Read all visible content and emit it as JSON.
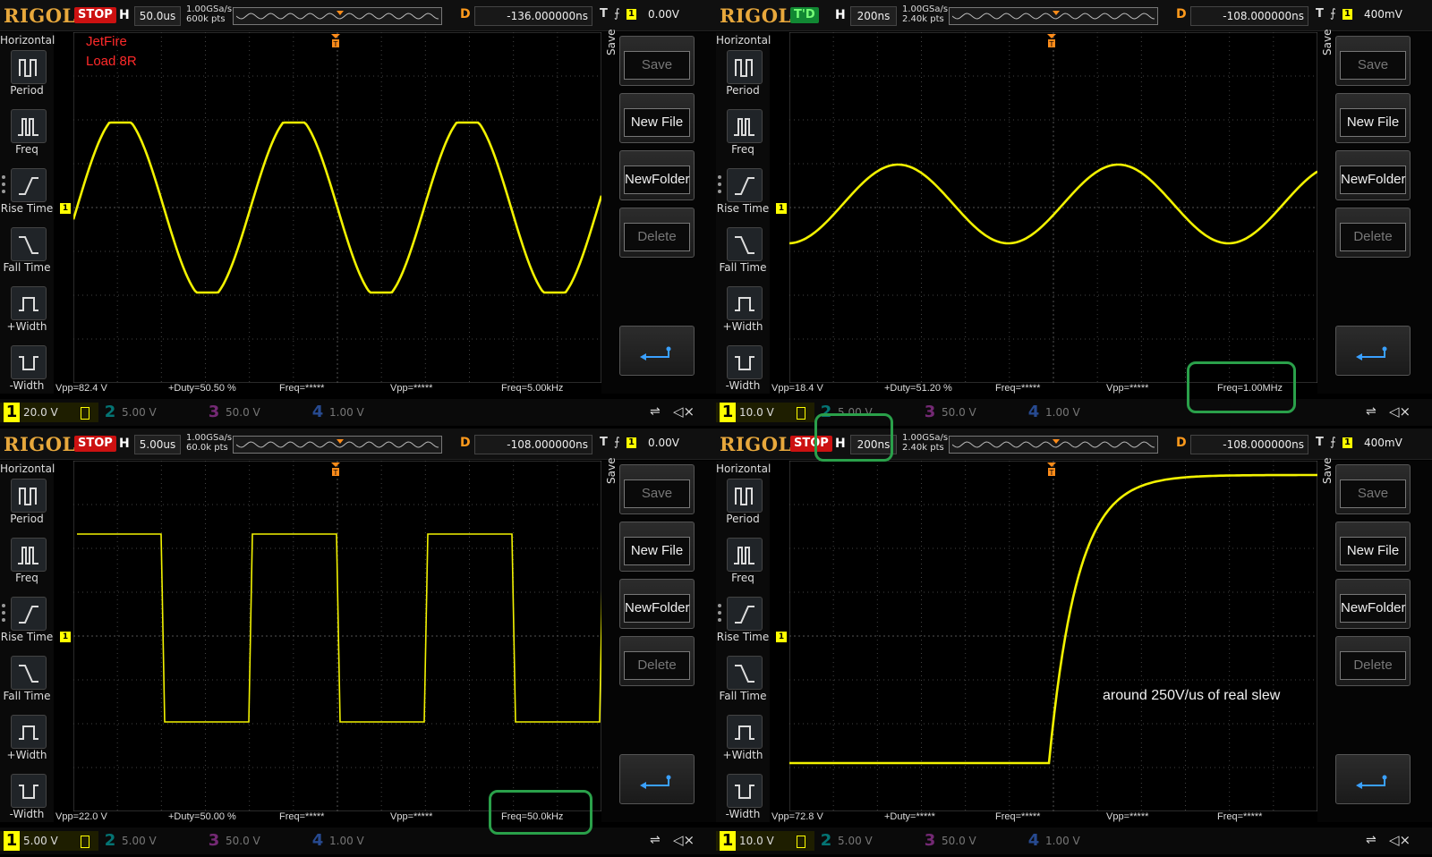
{
  "panels": [
    {
      "brand": "RIGOL",
      "status": "STOP",
      "status_type": "stop",
      "h_label": "H",
      "timebase": "50.0us",
      "sa_rate": "1.00GSa/s",
      "mem_depth": "600k pts",
      "d_label": "D",
      "delay": "-136.000000ns",
      "t_label": "T",
      "trigger_slope": "⨍",
      "trigger_ch": "1",
      "trigger_level": "0.00V",
      "side_title": "Horizontal",
      "side_items": [
        "Period",
        "Freq",
        "Rise Time",
        "Fall Time",
        "+Width",
        "-Width"
      ],
      "softkey_title": "Save",
      "softkeys": [
        "Save",
        "New File",
        "NewFolder",
        "Delete"
      ],
      "measurements": [
        "Vpp=82.4 V",
        "+Duty=50.50 %",
        "Freq=*****",
        "Vpp=*****",
        "Freq=5.00kHz"
      ],
      "channels": [
        {
          "num": "1",
          "scale": "20.0 V",
          "color": "#ffff00"
        },
        {
          "num": "2",
          "scale": "5.00 V",
          "color": "#00cccc"
        },
        {
          "num": "3",
          "scale": "50.0 V",
          "color": "#cc44cc"
        },
        {
          "num": "4",
          "scale": "1.00 V",
          "color": "#3f7fff"
        }
      ],
      "annotations": [
        "JetFire",
        "Load 8R"
      ],
      "waveform": "sine-clipped"
    },
    {
      "brand": "RIGOL",
      "status": "T'D",
      "status_type": "td",
      "h_label": "H",
      "timebase": "200ns",
      "sa_rate": "1.00GSa/s",
      "mem_depth": "2.40k pts",
      "d_label": "D",
      "delay": "-108.000000ns",
      "t_label": "T",
      "trigger_slope": "⨍",
      "trigger_ch": "1",
      "trigger_level": "400mV",
      "side_title": "Horizontal",
      "side_items": [
        "Period",
        "Freq",
        "Rise Time",
        "Fall Time",
        "+Width",
        "-Width"
      ],
      "softkey_title": "Save",
      "softkeys": [
        "Save",
        "New File",
        "NewFolder",
        "Delete"
      ],
      "measurements": [
        "Vpp=18.4 V",
        "+Duty=51.20 %",
        "Freq=*****",
        "Vpp=*****",
        "Freq=1.00MHz"
      ],
      "channels": [
        {
          "num": "1",
          "scale": "10.0 V",
          "color": "#ffff00"
        },
        {
          "num": "2",
          "scale": "5.00 V",
          "color": "#00cccc"
        },
        {
          "num": "3",
          "scale": "50.0 V",
          "color": "#cc44cc"
        },
        {
          "num": "4",
          "scale": "1.00 V",
          "color": "#3f7fff"
        }
      ],
      "annotations": [],
      "waveform": "sine-small"
    },
    {
      "brand": "RIGOL",
      "status": "STOP",
      "status_type": "stop",
      "h_label": "H",
      "timebase": "5.00us",
      "sa_rate": "1.00GSa/s",
      "mem_depth": "60.0k pts",
      "d_label": "D",
      "delay": "-108.000000ns",
      "t_label": "T",
      "trigger_slope": "⨍",
      "trigger_ch": "1",
      "trigger_level": "0.00V",
      "side_title": "Horizontal",
      "side_items": [
        "Period",
        "Freq",
        "Rise Time",
        "Fall Time",
        "+Width",
        "-Width"
      ],
      "softkey_title": "Save",
      "softkeys": [
        "Save",
        "New File",
        "NewFolder",
        "Delete"
      ],
      "measurements": [
        "Vpp=22.0 V",
        "+Duty=50.00 %",
        "Freq=*****",
        "Vpp=*****",
        "Freq=50.0kHz"
      ],
      "channels": [
        {
          "num": "1",
          "scale": "5.00 V",
          "color": "#ffff00"
        },
        {
          "num": "2",
          "scale": "5.00 V",
          "color": "#00cccc"
        },
        {
          "num": "3",
          "scale": "50.0 V",
          "color": "#cc44cc"
        },
        {
          "num": "4",
          "scale": "1.00 V",
          "color": "#3f7fff"
        }
      ],
      "annotations": [],
      "waveform": "square"
    },
    {
      "brand": "RIGOL",
      "status": "STOP",
      "status_type": "stop",
      "h_label": "H",
      "timebase": "200ns",
      "sa_rate": "1.00GSa/s",
      "mem_depth": "2.40k pts",
      "d_label": "D",
      "delay": "-108.000000ns",
      "t_label": "T",
      "trigger_slope": "⨍",
      "trigger_ch": "1",
      "trigger_level": "400mV",
      "side_title": "Horizontal",
      "side_items": [
        "Period",
        "Freq",
        "Rise Time",
        "Fall Time",
        "+Width",
        "-Width"
      ],
      "softkey_title": "Save",
      "softkeys": [
        "Save",
        "New File",
        "NewFolder",
        "Delete"
      ],
      "measurements": [
        "Vpp=72.8 V",
        "+Duty=*****",
        "Freq=*****",
        "Vpp=*****",
        "Freq=*****"
      ],
      "channels": [
        {
          "num": "1",
          "scale": "10.0 V",
          "color": "#ffff00"
        },
        {
          "num": "2",
          "scale": "5.00 V",
          "color": "#00cccc"
        },
        {
          "num": "3",
          "scale": "50.0 V",
          "color": "#cc44cc"
        },
        {
          "num": "4",
          "scale": "1.00 V",
          "color": "#3f7fff"
        }
      ],
      "annotations": [
        "around 250V/us of real slew"
      ],
      "waveform": "step"
    }
  ],
  "icons": {
    "usb": "usb-icon",
    "mute": "speaker-mute-icon",
    "return": "return-arrow-icon"
  }
}
